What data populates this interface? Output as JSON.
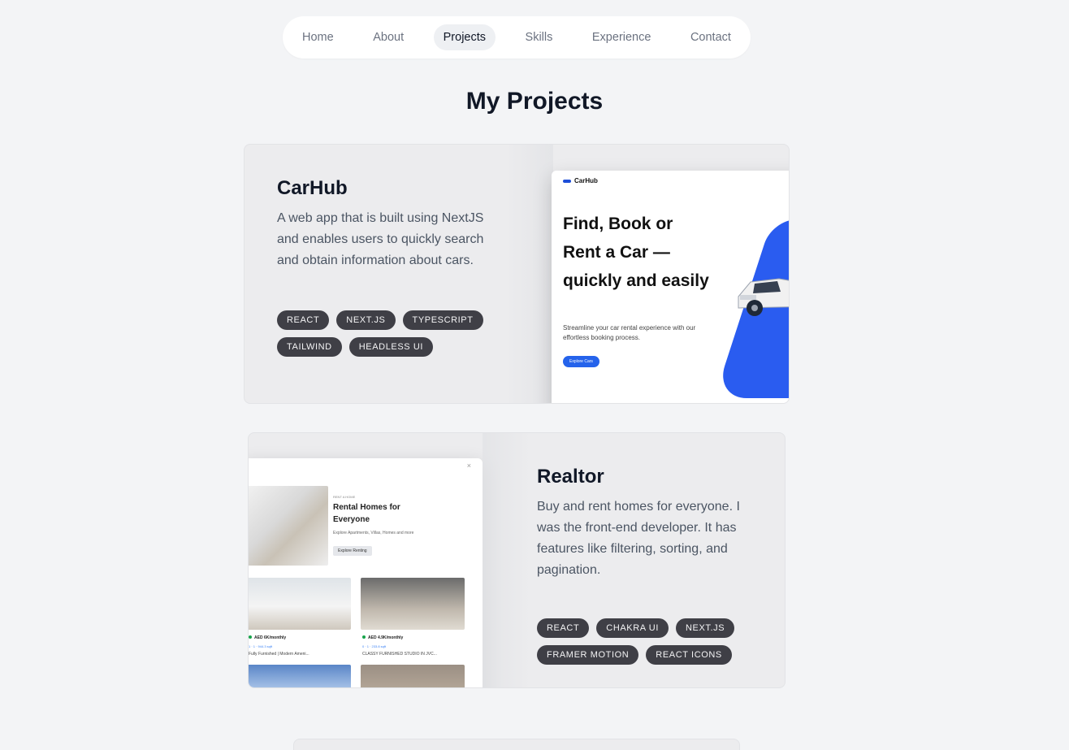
{
  "nav": {
    "items": [
      {
        "label": "Home"
      },
      {
        "label": "About"
      },
      {
        "label": "Projects"
      },
      {
        "label": "Skills"
      },
      {
        "label": "Experience"
      },
      {
        "label": "Contact"
      }
    ],
    "active": "Projects"
  },
  "page": {
    "title": "My Projects"
  },
  "projects": [
    {
      "title": "CarHub",
      "description": "A web app that is built using NextJS and enables users to quickly search and obtain information about cars.",
      "tags": [
        "REACT",
        "NEXT.JS",
        "TYPESCRIPT",
        "TAILWIND",
        "HEADLESS UI"
      ],
      "preview": {
        "logo": "CarHub",
        "headline": "Find, Book or Rent a Car — quickly and easily",
        "subtext": "Streamline your car rental experience with our effortless booking process.",
        "button": "Explore Cars"
      }
    },
    {
      "title": "Realtor",
      "description": "Buy and rent homes for everyone. I was the front-end developer. It has features like filtering, sorting, and pagination.",
      "tags": [
        "REACT",
        "CHAKRA UI",
        "NEXT.JS",
        "FRAMER MOTION",
        "REACT ICONS"
      ],
      "preview": {
        "close": "×",
        "kicker": "RENT A HOME",
        "headline": "Rental Homes for Everyone",
        "subtext": "Explore Apartments, Villas, Homes and more",
        "button": "Explore Renting",
        "listings": [
          {
            "price": "AED 6K/monthly",
            "meta": "1 · 1 · 944.3 sqft",
            "caption": "Fully Furnished | Modern Ameni..."
          },
          {
            "price": "AED 4.9K/monthly",
            "meta": "0 · 1 · 233.8 sqft",
            "caption": "CLASSY FURNISHED STUDIO IN JVC..."
          }
        ]
      }
    }
  ],
  "colors": {
    "background": "#f3f4f6",
    "card": "#ececee",
    "tag": "#3f3f46",
    "accent": "#2563eb"
  }
}
